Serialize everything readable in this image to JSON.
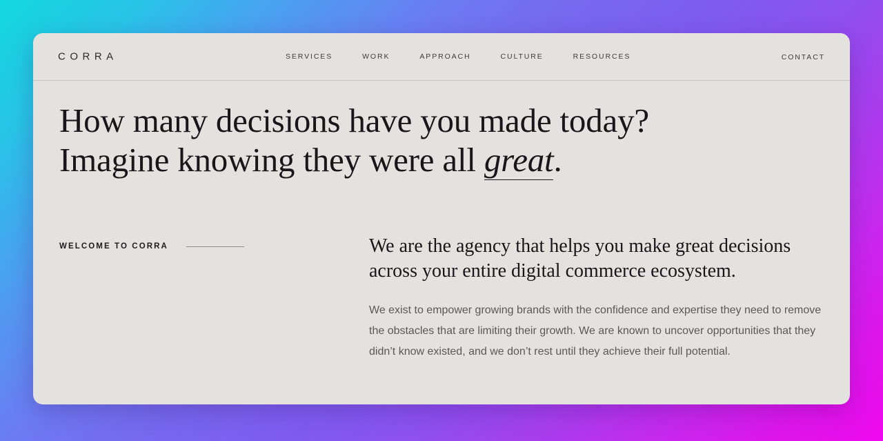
{
  "theme": {
    "card_bg": "#E4E2DE",
    "ink": "#17171A",
    "body_text": "#59595A",
    "rule": "#8C8A86",
    "gradient_start": "#12D8DE",
    "gradient_mid": "#7E5CF0",
    "gradient_end": "#EE08ED"
  },
  "header": {
    "logo": "CORRA",
    "nav": [
      {
        "label": "SERVICES"
      },
      {
        "label": "WORK"
      },
      {
        "label": "APPROACH"
      },
      {
        "label": "CULTURE"
      },
      {
        "label": "RESOURCES"
      }
    ],
    "contact": "CONTACT"
  },
  "hero": {
    "line1": "How many decisions have you made today?",
    "line2_before": "Imagine knowing they were all ",
    "line2_emphasis": "great",
    "line2_after": "."
  },
  "intro": {
    "eyebrow": "WELCOME TO CORRA",
    "lede": "We are the agency that helps you make great decisions across your entire digital commerce ecosystem.",
    "body": "We exist to empower growing brands with the confidence and expertise they need to remove the obstacles that are limiting their growth. We are known to uncover opportunities that they didn’t know existed, and we don’t rest until they achieve their full potential."
  }
}
